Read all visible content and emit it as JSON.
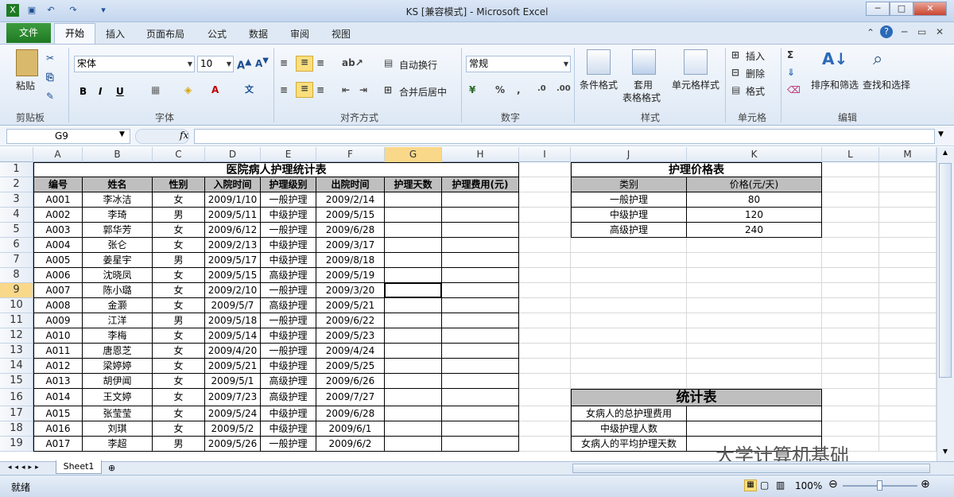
{
  "window": {
    "title": "KS  [兼容模式] - Microsoft Excel"
  },
  "tabs": [
    "文件",
    "开始",
    "插入",
    "页面布局",
    "公式",
    "数据",
    "审阅",
    "视图"
  ],
  "ribbon": {
    "clipboard": {
      "paste": "粘贴",
      "group": "剪贴板"
    },
    "font": {
      "name": "宋体",
      "size": "10",
      "group": "字体"
    },
    "alignment": {
      "wrap": "自动换行",
      "merge": "合并后居中",
      "group": "对齐方式"
    },
    "number": {
      "format": "常规",
      "group": "数字"
    },
    "styles": {
      "cond": "条件格式",
      "table": "套用",
      "table2": "表格格式",
      "cellstyle": "单元格样式",
      "group": "样式"
    },
    "cells": {
      "insert": "插入",
      "delete": "删除",
      "format": "格式",
      "group": "单元格"
    },
    "editing": {
      "sort": "排序和筛选",
      "find": "查找和选择",
      "group": "编辑"
    }
  },
  "formula": {
    "namebox": "G9",
    "fx": "fx"
  },
  "columns": [
    "A",
    "B",
    "C",
    "D",
    "E",
    "F",
    "G",
    "H",
    "I",
    "J",
    "K",
    "L",
    "M"
  ],
  "rownums": [
    "1",
    "2",
    "3",
    "4",
    "5",
    "6",
    "7",
    "8",
    "9",
    "10",
    "11",
    "12",
    "13",
    "14",
    "15",
    "16",
    "17",
    "18",
    "19"
  ],
  "table1": {
    "title": "医院病人护理统计表",
    "headers": [
      "编号",
      "姓名",
      "性别",
      "入院时间",
      "护理级别",
      "出院时间",
      "护理天数",
      "护理费用(元)"
    ],
    "rows": [
      [
        "A001",
        "李冰洁",
        "女",
        "2009/1/10",
        "一般护理",
        "2009/2/14"
      ],
      [
        "A002",
        "李琦",
        "男",
        "2009/5/11",
        "中级护理",
        "2009/5/15"
      ],
      [
        "A003",
        "郭华芳",
        "女",
        "2009/6/12",
        "一般护理",
        "2009/6/28"
      ],
      [
        "A004",
        "张仑",
        "女",
        "2009/2/13",
        "中级护理",
        "2009/3/17"
      ],
      [
        "A005",
        "姜星宇",
        "男",
        "2009/5/17",
        "中级护理",
        "2009/8/18"
      ],
      [
        "A006",
        "沈晓凤",
        "女",
        "2009/5/15",
        "高级护理",
        "2009/5/19"
      ],
      [
        "A007",
        "陈小璐",
        "女",
        "2009/2/10",
        "一般护理",
        "2009/3/20"
      ],
      [
        "A008",
        "金灏",
        "女",
        "2009/5/7",
        "高级护理",
        "2009/5/21"
      ],
      [
        "A009",
        "江洋",
        "男",
        "2009/5/18",
        "一般护理",
        "2009/6/22"
      ],
      [
        "A010",
        "李梅",
        "女",
        "2009/5/14",
        "中级护理",
        "2009/5/23"
      ],
      [
        "A011",
        "唐恩芝",
        "女",
        "2009/4/20",
        "一般护理",
        "2009/4/24"
      ],
      [
        "A012",
        "梁婷婷",
        "女",
        "2009/5/21",
        "中级护理",
        "2009/5/25"
      ],
      [
        "A013",
        "胡伊闻",
        "女",
        "2009/5/1",
        "高级护理",
        "2009/6/26"
      ],
      [
        "A014",
        "王文婷",
        "女",
        "2009/7/23",
        "高级护理",
        "2009/7/27"
      ],
      [
        "A015",
        "张莹莹",
        "女",
        "2009/5/24",
        "中级护理",
        "2009/6/28"
      ],
      [
        "A016",
        "刘琪",
        "女",
        "2009/5/2",
        "中级护理",
        "2009/6/1"
      ],
      [
        "A017",
        "李超",
        "男",
        "2009/5/26",
        "一般护理",
        "2009/6/2"
      ]
    ]
  },
  "table2": {
    "title": "护理价格表",
    "headers": [
      "类别",
      "价格(元/天)"
    ],
    "rows": [
      [
        "一般护理",
        "80"
      ],
      [
        "中级护理",
        "120"
      ],
      [
        "高级护理",
        "240"
      ]
    ]
  },
  "table3": {
    "title": "统计表",
    "rows": [
      "女病人的总护理费用",
      "中级护理人数",
      "女病人的平均护理天数"
    ]
  },
  "sheet": {
    "name": "Sheet1"
  },
  "status": {
    "ready": "就绪",
    "zoom": "100%"
  },
  "watermark": "大学计算机基础"
}
